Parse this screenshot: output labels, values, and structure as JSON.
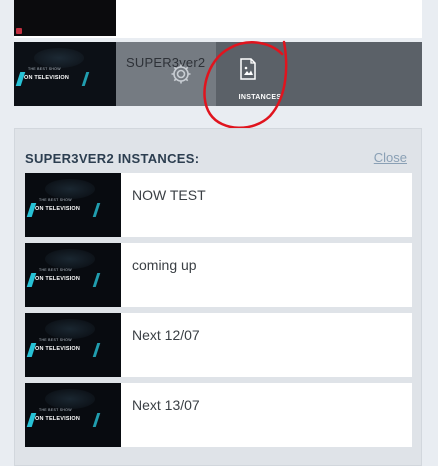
{
  "template": {
    "name": "SUPER3ver2",
    "instances_label": "INSTANCES",
    "thumb_small": "THE BEST SHOW",
    "thumb_main": "ON TELEVISION"
  },
  "instances_panel": {
    "title": "SUPER3VER2 INSTANCES:",
    "close_label": "Close",
    "items": [
      {
        "name": "NOW TEST",
        "thumb_small": "THE BEST SHOW",
        "thumb_main": "ON TELEVISION"
      },
      {
        "name": "coming up",
        "thumb_small": "THE BEST SHOW",
        "thumb_main": "ON TELEVISION"
      },
      {
        "name": "Next 12/07",
        "thumb_small": "THE BEST SHOW",
        "thumb_main": "ON TELEVISION"
      },
      {
        "name": "Next 13/07",
        "thumb_small": "THE BEST SHOW",
        "thumb_main": "ON TELEVISION"
      }
    ]
  },
  "icons": [
    "gear-icon",
    "image-file-icon"
  ],
  "colors": {
    "accent_cyan": "#27c2d6",
    "annotation_red": "#e0141e",
    "link": "#8aa0b5"
  }
}
